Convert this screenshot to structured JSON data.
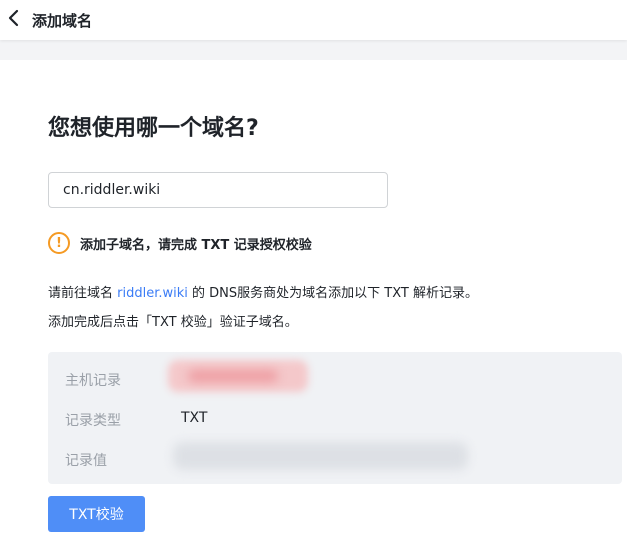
{
  "header": {
    "back_icon": "chevron-left-icon",
    "title": "添加域名"
  },
  "main": {
    "question": "您想使用哪一个域名?",
    "domain_input_value": "cn.riddler.wiki",
    "warning": {
      "icon": "warning-circle-icon",
      "icon_glyph": "!",
      "text": "添加子域名，请完成 TXT 记录授权校验",
      "color": "#f59a23"
    },
    "instruction_prefix": "请前往域名 ",
    "instruction_link": "riddler.wiki",
    "instruction_suffix": " 的 DNS服务商处为域名添加以下 TXT 解析记录。",
    "instruction_line2": "添加完成后点击「TXT 校验」验证子域名。",
    "records": {
      "host_label": "主机记录",
      "type_label": "记录类型",
      "type_value": "TXT",
      "value_label": "记录值"
    },
    "verify_button": "TXT校验"
  },
  "colors": {
    "accent": "#3b7cf6",
    "button": "#4f8ef7",
    "panel": "#f0f2f5"
  }
}
